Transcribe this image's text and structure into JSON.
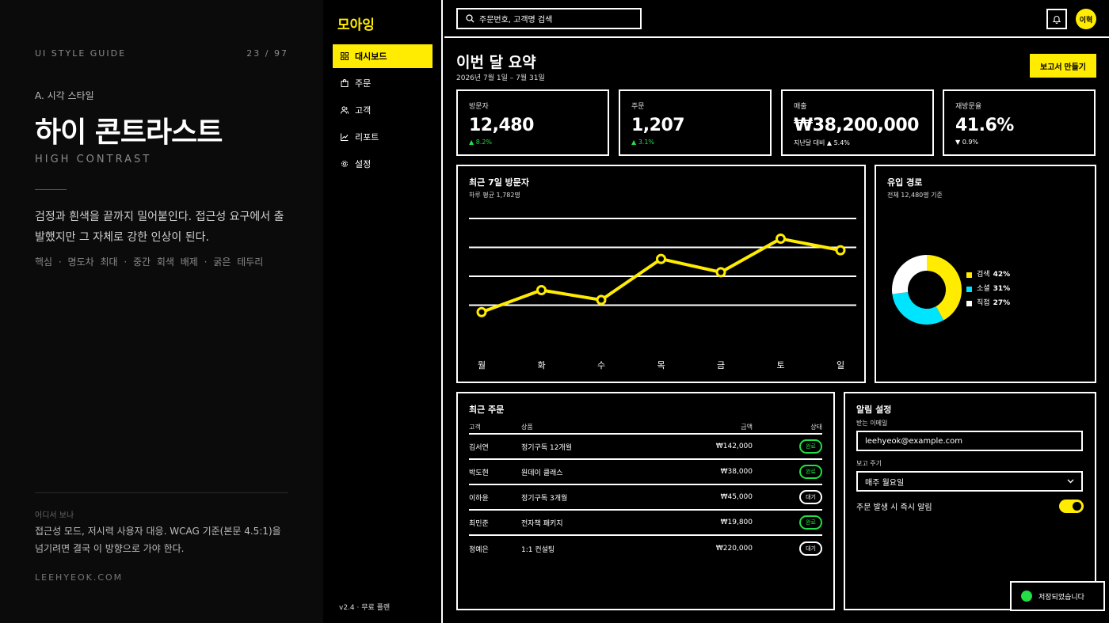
{
  "guide": {
    "header_left": "UI STYLE GUIDE",
    "header_right": "23 / 97",
    "section": "A. 시각 스타일",
    "title": "하이 콘트라스트",
    "subtitle": "HIGH CONTRAST",
    "description": "검정과 흰색을 끝까지 밀어붙인다. 접근성 요구에서 출발했지만 그 자체로 강한 인상이 된다.",
    "tags": "핵심 · 명도차 최대 · 중간 회색 배제 · 굵은 테두리",
    "where_label": "어디서 보나",
    "where_text": "접근성 모드, 저시력 사용자 대응. WCAG 기준(본문 4.5:1)을 넘기려면 결국 이 방향으로 가야 한다.",
    "site": "LEEHYEOK.COM"
  },
  "app": {
    "logo": "모아잉",
    "nav": [
      {
        "label": "대시보드",
        "icon": "grid-icon",
        "active": true
      },
      {
        "label": "주문",
        "icon": "bag-icon",
        "active": false
      },
      {
        "label": "고객",
        "icon": "users-icon",
        "active": false
      },
      {
        "label": "리포트",
        "icon": "chart-icon",
        "active": false
      },
      {
        "label": "설정",
        "icon": "gear-icon",
        "active": false
      }
    ],
    "version": "v2.4 · 무료 플랜",
    "search_placeholder": "주문번호, 고객명 검색",
    "avatar": "이혁",
    "colors": {
      "accent": "#ffec00",
      "bg": "#000000",
      "fg": "#ffffff",
      "positive": "#22dd44",
      "cyan": "#00e5ff"
    }
  },
  "summary": {
    "title": "이번 달 요약",
    "range": "2026년 7월 1일 – 7월 31일",
    "report_button": "보고서 만들기"
  },
  "stats": [
    {
      "label": "방문자",
      "value": "12,480",
      "change": "▲ 8.2%",
      "positive": true
    },
    {
      "label": "주문",
      "value": "1,207",
      "change": "▲ 3.1%",
      "positive": true
    },
    {
      "label": "매출",
      "value": "₩38,200,000",
      "change": "지난달 대비 ▲ 5.4%",
      "positive": false
    },
    {
      "label": "재방문율",
      "value": "41.6%",
      "change": "▼ 0.9%",
      "positive": false
    }
  ],
  "visitors_chart": {
    "title": "최근 7일 방문자",
    "subtitle": "하루 평균 1,782명"
  },
  "traffic_chart": {
    "title": "유입 경로",
    "subtitle": "전체 12,480명 기준"
  },
  "chart_data": [
    {
      "type": "line",
      "title": "최근 7일 방문자",
      "categories": [
        "월",
        "화",
        "수",
        "목",
        "금",
        "토",
        "일"
      ],
      "values": [
        1380,
        1760,
        1590,
        2300,
        2070,
        2650,
        2450
      ],
      "ylim": [
        1000,
        3000
      ],
      "grid": true
    },
    {
      "type": "pie",
      "title": "유입 경로",
      "labels": [
        "검색",
        "소셜",
        "직접"
      ],
      "values": [
        42,
        31,
        27
      ],
      "value_labels": [
        "42%",
        "31%",
        "27%"
      ],
      "colors": [
        "#ffec00",
        "#00e5ff",
        "#ffffff"
      ],
      "donut": true,
      "legend": "right"
    }
  ],
  "orders": {
    "title": "최근 주문",
    "columns": [
      "고객",
      "상품",
      "금액",
      "상태"
    ],
    "rows": [
      {
        "customer": "김서연",
        "product": "정기구독 12개월",
        "amount": "₩142,000",
        "status": "완료",
        "done": true
      },
      {
        "customer": "박도현",
        "product": "원데이 클래스",
        "amount": "₩38,000",
        "status": "완료",
        "done": true
      },
      {
        "customer": "이하윤",
        "product": "정기구독 3개월",
        "amount": "₩45,000",
        "status": "대기",
        "done": false
      },
      {
        "customer": "최민준",
        "product": "전자책 패키지",
        "amount": "₩19,800",
        "status": "완료",
        "done": true
      },
      {
        "customer": "정예은",
        "product": "1:1 컨설팅",
        "amount": "₩220,000",
        "status": "대기",
        "done": false
      }
    ]
  },
  "settings": {
    "title": "알림 설정",
    "email_label": "받는 이메일",
    "email_value": "leehyeok@example.com",
    "period_label": "보고 주기",
    "period_value": "매주 월요일",
    "toggle_label": "주문 발생 시 즉시 알림",
    "toggle_on": true
  },
  "toast": "저장되었습니다"
}
